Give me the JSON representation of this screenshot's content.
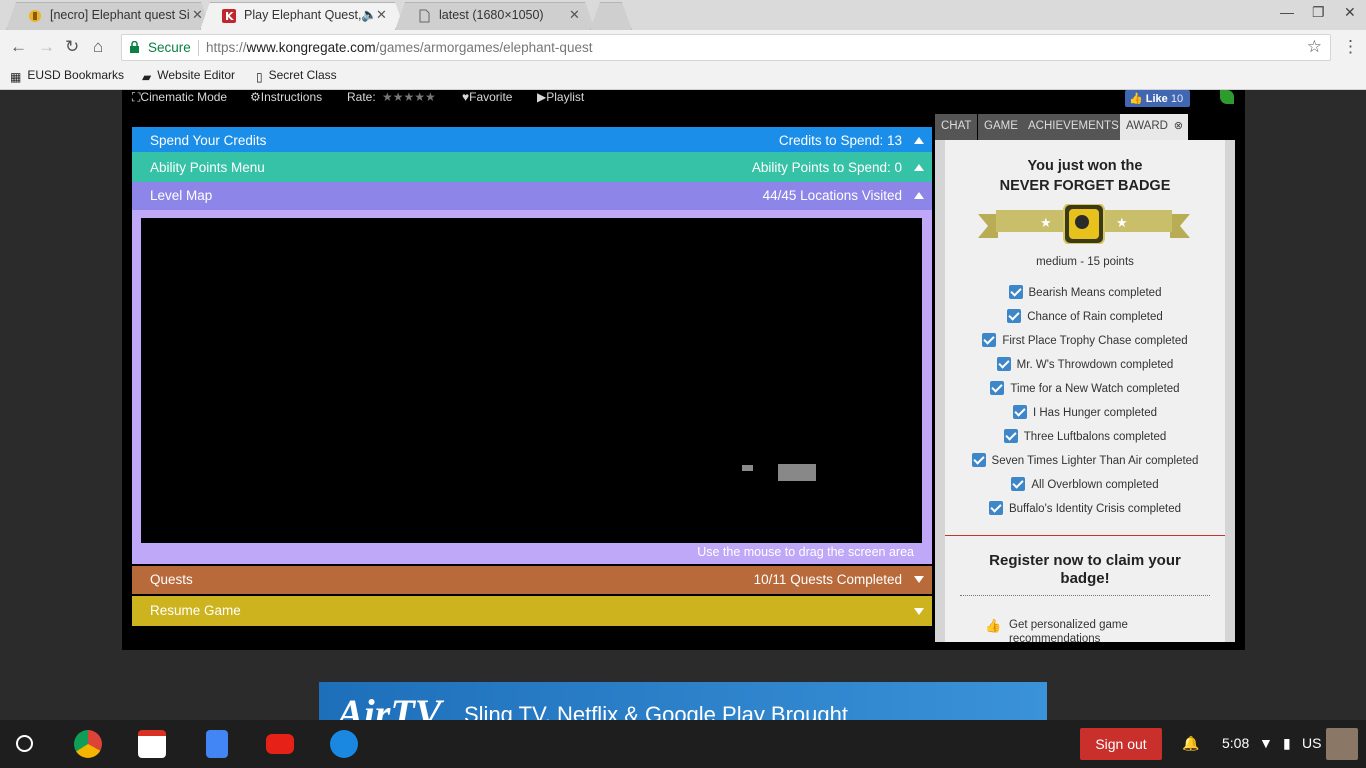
{
  "browser": {
    "tabs": [
      {
        "title": "[necro] Elephant quest Si",
        "active": false
      },
      {
        "title": "Play Elephant Quest,",
        "active": true
      },
      {
        "title": "latest (1680×1050)",
        "active": false
      }
    ],
    "security_label": "Secure",
    "url_scheme": "https://",
    "url_host": "www.kongregate.com",
    "url_path": "/games/armorgames/elephant-quest",
    "bookmarks": [
      "EUSD Bookmarks",
      "Website Editor",
      "Secret Class"
    ]
  },
  "game_bar": {
    "cinematic": "Cinematic Mode",
    "instructions": "Instructions",
    "rate": "Rate:",
    "favorite": "Favorite",
    "playlist": "Playlist",
    "fb_like": "Like",
    "fb_count": "10"
  },
  "menus": {
    "credits": {
      "label": "Spend Your Credits",
      "value": "Credits to Spend: 13",
      "color": "#1a8ee8"
    },
    "ability": {
      "label": "Ability Points Menu",
      "value": "Ability Points to Spend: 0",
      "color": "#36c2a6"
    },
    "map": {
      "label": "Level Map",
      "value": "44/45 Locations Visited",
      "color": "#8d86e8"
    },
    "map_hint": "Use the mouse to drag the screen area",
    "quests": {
      "label": "Quests",
      "value": "10/11 Quests Completed",
      "color": "#b86a3a"
    },
    "resume": {
      "label": "Resume Game",
      "color": "#cdb41e"
    }
  },
  "side": {
    "tabs": [
      "CHAT",
      "GAME",
      "ACHIEVEMENTS",
      "AWARD"
    ],
    "won_line1": "You just won the",
    "won_line2": "NEVER FORGET BADGE",
    "points": "medium - 15 points",
    "achievements": [
      "Bearish Means completed",
      "Chance of Rain completed",
      "First Place Trophy Chase completed",
      "Mr. W's Throwdown completed",
      "Time for a New Watch completed",
      "I Has Hunger completed",
      "Three Luftbalons completed",
      "Seven Times Lighter Than Air completed",
      "All Overblown completed",
      "Buffalo's Identity Crisis completed"
    ],
    "register": "Register now to claim your badge!",
    "perk": "Get personalized game recommendations"
  },
  "ad": {
    "logo": "AirTV",
    "text": "Sling TV, Netflix & Google Play Brought"
  },
  "shelf": {
    "signout": "Sign out",
    "time": "5:08",
    "locale": "US"
  }
}
